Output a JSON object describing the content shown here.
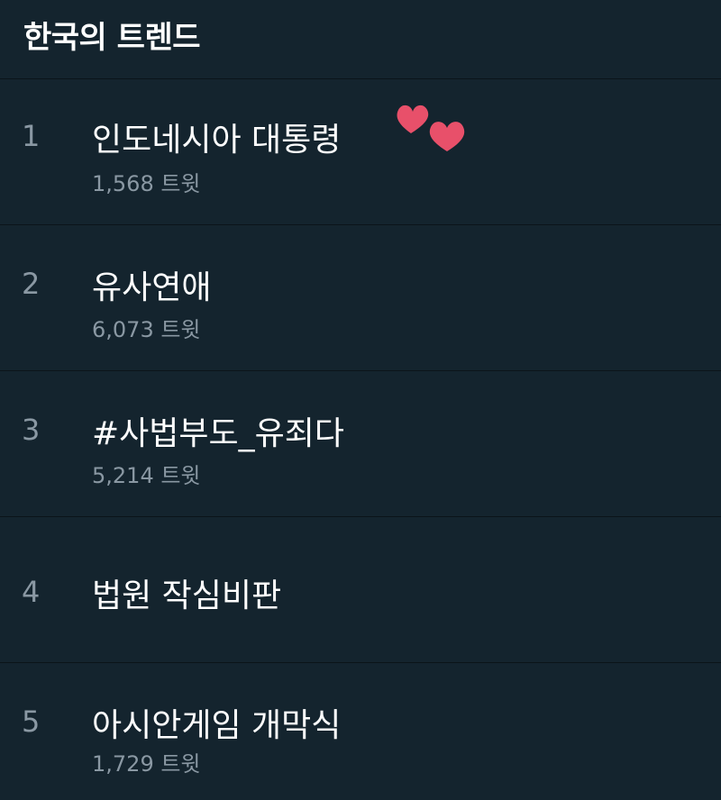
{
  "header": {
    "title": "한국의 트렌드"
  },
  "trends": [
    {
      "rank": "1",
      "topic": "인도네시아 대통령",
      "count": "1,568 트윗"
    },
    {
      "rank": "2",
      "topic": "유사연애",
      "count": "6,073 트윗"
    },
    {
      "rank": "3",
      "topic": "#사법부도_유죄다",
      "count": "5,214 트윗"
    },
    {
      "rank": "4",
      "topic": "법원 작심비판"
    },
    {
      "rank": "5",
      "topic": "아시안게임 개막식",
      "count": "1,729 트윗"
    }
  ],
  "decorations": {
    "icon": "hearts-icon",
    "color": "#e8506a"
  },
  "colors": {
    "background": "#14242e",
    "divider": "#0b1419",
    "muted": "#8a98a3"
  }
}
